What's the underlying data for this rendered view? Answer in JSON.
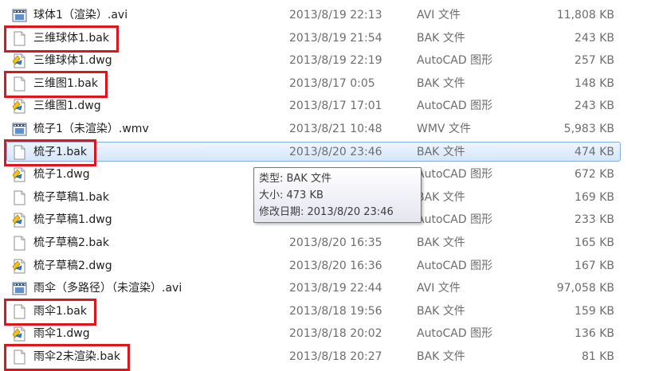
{
  "colors": {
    "highlight_box": "#e0141c",
    "selection_border": "#84acdd",
    "selection_fill": "#d4e6fb",
    "name_text": "#1e1e1e",
    "meta_text": "#6d6d6d"
  },
  "files": [
    {
      "name": "球体1（渲染）.avi",
      "date": "2013/8/19 22:13",
      "type": "AVI 文件",
      "size": "11,808 KB",
      "icon": "video-file-icon",
      "selected": false,
      "highlighted": false
    },
    {
      "name": "三维球体1.bak",
      "date": "2013/8/19 21:54",
      "type": "BAK 文件",
      "size": "243 KB",
      "icon": "blank-file-icon",
      "selected": false,
      "highlighted": true
    },
    {
      "name": "三维球体1.dwg",
      "date": "2013/8/19 22:19",
      "type": "AutoCAD 图形",
      "size": "257 KB",
      "icon": "dwg-file-icon",
      "selected": false,
      "highlighted": false
    },
    {
      "name": "三维图1.bak",
      "date": "2013/8/17 0:05",
      "type": "BAK 文件",
      "size": "148 KB",
      "icon": "blank-file-icon",
      "selected": false,
      "highlighted": true
    },
    {
      "name": "三维图1.dwg",
      "date": "2013/8/17 17:01",
      "type": "AutoCAD 图形",
      "size": "243 KB",
      "icon": "dwg-file-icon",
      "selected": false,
      "highlighted": false
    },
    {
      "name": "梳子1（未渲染）.wmv",
      "date": "2013/8/21 10:48",
      "type": "WMV 文件",
      "size": "5,983 KB",
      "icon": "video-file-icon",
      "selected": false,
      "highlighted": false
    },
    {
      "name": "梳子1.bak",
      "date": "2013/8/20 23:46",
      "type": "BAK 文件",
      "size": "474 KB",
      "icon": "blank-file-icon",
      "selected": true,
      "highlighted": true
    },
    {
      "name": "梳子1.dwg",
      "date": "",
      "type": "AutoCAD 图形",
      "size": "672 KB",
      "icon": "dwg-file-icon",
      "selected": false,
      "highlighted": false
    },
    {
      "name": "梳子草稿1.bak",
      "date": "",
      "type": "BAK 文件",
      "size": "169 KB",
      "icon": "blank-file-icon",
      "selected": false,
      "highlighted": false
    },
    {
      "name": "梳子草稿1.dwg",
      "date": "",
      "type": "AutoCAD 图形",
      "size": "233 KB",
      "icon": "dwg-file-icon",
      "selected": false,
      "highlighted": false
    },
    {
      "name": "梳子草稿2.bak",
      "date": "2013/8/20 16:35",
      "type": "BAK 文件",
      "size": "165 KB",
      "icon": "blank-file-icon",
      "selected": false,
      "highlighted": false
    },
    {
      "name": "梳子草稿2.dwg",
      "date": "2013/8/20 16:36",
      "type": "AutoCAD 图形",
      "size": "167 KB",
      "icon": "dwg-file-icon",
      "selected": false,
      "highlighted": false
    },
    {
      "name": "雨伞（多路径）（未渲染）.avi",
      "date": "2013/8/19 22:44",
      "type": "AVI 文件",
      "size": "97,058 KB",
      "icon": "video-file-icon",
      "selected": false,
      "highlighted": false
    },
    {
      "name": "雨伞1.bak",
      "date": "2013/8/18 19:56",
      "type": "BAK 文件",
      "size": "159 KB",
      "icon": "blank-file-icon",
      "selected": false,
      "highlighted": true
    },
    {
      "name": "雨伞1.dwg",
      "date": "2013/8/18 20:02",
      "type": "AutoCAD 图形",
      "size": "136 KB",
      "icon": "dwg-file-icon",
      "selected": false,
      "highlighted": false
    },
    {
      "name": "雨伞2未渲染.bak",
      "date": "2013/8/18 20:27",
      "type": "BAK 文件",
      "size": "81 KB",
      "icon": "blank-file-icon",
      "selected": false,
      "highlighted": true
    }
  ],
  "tooltip": {
    "type_line": "类型: BAK 文件",
    "size_line": "大小: 473 KB",
    "modified_line": "修改日期: 2013/8/20 23:46"
  }
}
